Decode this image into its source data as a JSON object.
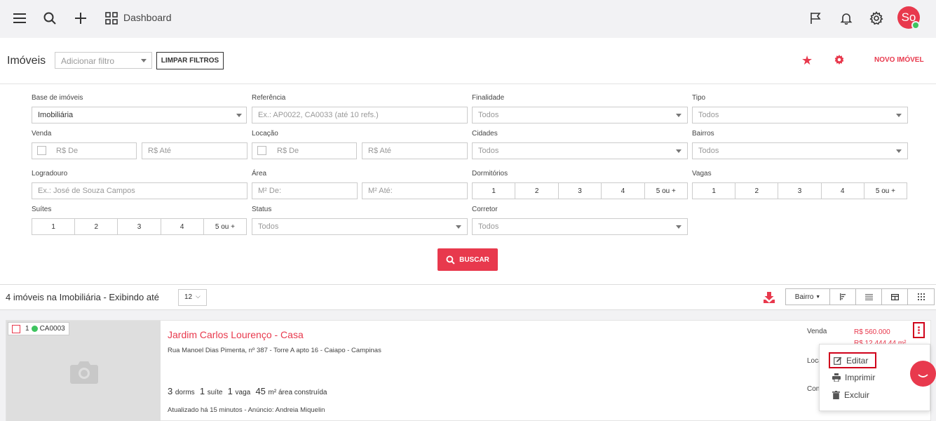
{
  "topbar": {
    "title": "Dashboard",
    "avatar_initials": "So"
  },
  "header": {
    "title": "Imóveis",
    "filter_placeholder": "Adicionar filtro",
    "clear_filters": "LIMPAR FILTROS",
    "new_property": "NOVO IMÓVEL"
  },
  "filters": {
    "base_label": "Base de imóveis",
    "base_value": "Imobiliária",
    "referencia_label": "Referência",
    "referencia_placeholder": "Ex.: AP0022, CA0033 (até 10 refs.)",
    "finalidade_label": "Finalidade",
    "finalidade_value": "Todos",
    "tipo_label": "Tipo",
    "tipo_value": "Todos",
    "venda_label": "Venda",
    "venda_de": "R$ De",
    "venda_ate": "R$ Até",
    "locacao_label": "Locação",
    "locacao_de": "R$ De",
    "locacao_ate": "R$ Até",
    "cidades_label": "Cidades",
    "cidades_value": "Todos",
    "bairros_label": "Bairros",
    "bairros_value": "Todos",
    "logradouro_label": "Logradouro",
    "logradouro_placeholder": "Ex.: José de Souza Campos",
    "area_label": "Área",
    "area_de": "M² De:",
    "area_ate": "M² Até:",
    "dormitorios_label": "Dormitórios",
    "vagas_label": "Vagas",
    "suites_label": "Suítes",
    "status_label": "Status",
    "status_value": "Todos",
    "corretor_label": "Corretor",
    "corretor_value": "Todos",
    "count_options": [
      "1",
      "2",
      "3",
      "4",
      "5 ou +"
    ],
    "search_button": "BUSCAR"
  },
  "results": {
    "count_text": "4 imóveis na Imobiliária - Exibindo até",
    "per_page": "12",
    "sort_label": "Bairro"
  },
  "card": {
    "index": "1",
    "ref": "CA0003",
    "title": "Jardim Carlos Lourenço - Casa",
    "address": "Rua Manoel Dias Pimenta, nº 387 - Torre A apto 16 - Caiapo - Campinas",
    "dorms_n": "3",
    "dorms_l": "dorms",
    "suite_n": "1",
    "suite_l": "suíte",
    "vaga_n": "1",
    "vaga_l": "vaga",
    "area_n": "45",
    "area_l": "m² área construída",
    "updated": "Atualizado há 15 minutos - Anúncio: Andreia Miquelin",
    "venda_label": "Venda",
    "venda_value_prefix": "R$ ",
    "venda_value": "560.000",
    "venda_m2": "R$ 12.444,44 m²",
    "locacao_label": "Loca",
    "condominio_label": "Con"
  },
  "menu": {
    "edit": "Editar",
    "print": "Imprimir",
    "delete": "Excluir"
  },
  "colors": {
    "accent": "#e8394d",
    "highlight": "#d0021b",
    "online": "#3ec45f"
  }
}
